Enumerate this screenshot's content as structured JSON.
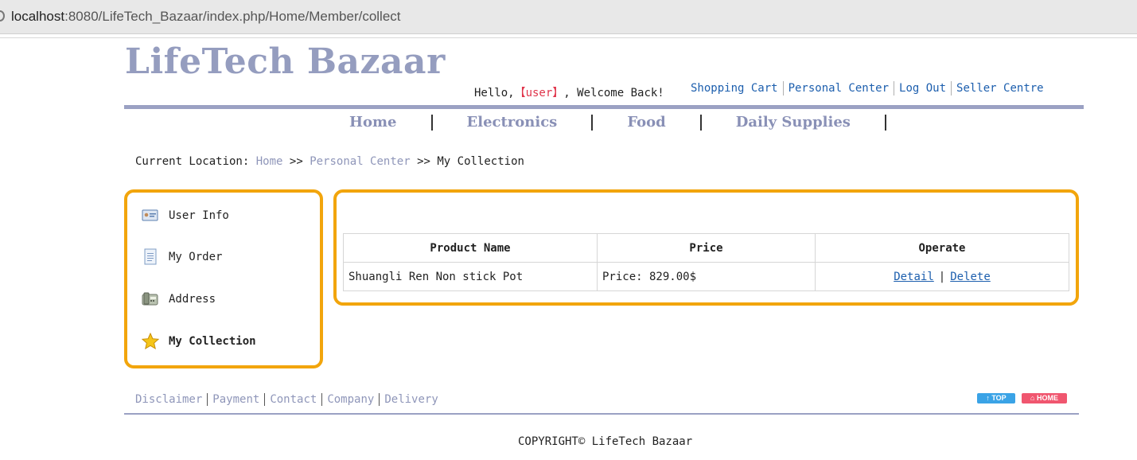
{
  "browser": {
    "url_host": "localhost",
    "url_rest": ":8080/LifeTech_Bazaar/index.php/Home/Member/collect"
  },
  "header": {
    "logo": "LifeTech Bazaar",
    "welcome_prefix": "Hello,",
    "welcome_user": "【user】",
    "welcome_suffix": ", Welcome Back!",
    "links": [
      "Shopping Cart",
      "Personal Center",
      "Log Out",
      "Seller Centre"
    ]
  },
  "nav": [
    "Home",
    "Electronics",
    "Food",
    "Daily Supplies"
  ],
  "breadcrumb": {
    "label": "Current Location:",
    "home": "Home",
    "sep": ">>",
    "personal_center": "Personal Center",
    "current": "My Collection"
  },
  "sidebar": {
    "items": [
      {
        "label": "User Info",
        "icon": "id-card-icon"
      },
      {
        "label": "My Order",
        "icon": "document-icon"
      },
      {
        "label": "Address",
        "icon": "phone-icon"
      },
      {
        "label": "My Collection",
        "icon": "star-icon",
        "active": true
      }
    ]
  },
  "table": {
    "headers": [
      "Product Name",
      "Price",
      "Operate"
    ],
    "rows": [
      {
        "name": "Shuangli Ren Non stick Pot",
        "price": "Price: 829.00$",
        "detail": "Detail",
        "delete": "Delete",
        "sep": "|"
      }
    ]
  },
  "footer": {
    "links": [
      "Disclaimer",
      "Payment",
      "Contact",
      "Company",
      "Delivery"
    ],
    "top_button": "↑ TOP",
    "home_button": "⌂ HOME",
    "copyright": "COPYRIGHT© LifeTech Bazaar"
  },
  "colors": {
    "accent_border": "#f2a50c",
    "logo": "#959dbf",
    "link": "#1d5fae",
    "user": "#e0354b"
  }
}
